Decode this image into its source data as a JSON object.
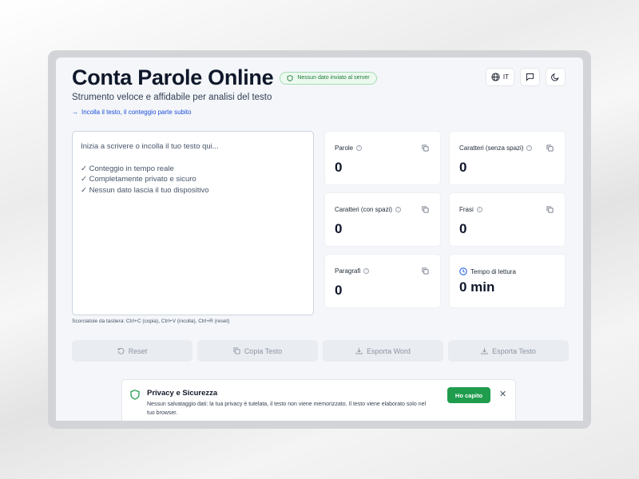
{
  "app": {
    "title": "Conta Parole Online",
    "privacy_pill": "Nessun dato inviato al server",
    "subtitle": "Strumento veloce e affidabile per analisi del testo",
    "hint": "Incolla il testo, il conteggio parte subito",
    "language": "IT"
  },
  "editor": {
    "placeholder_line1": "Inizia a scrivere o incolla il tuo testo qui...",
    "features": [
      "✓ Conteggio in tempo reale",
      "✓ Completamente privato e sicuro",
      "✓ Nessun dato lascia il tuo dispositivo"
    ],
    "shortcuts": "Scorciatoie da tastiera: Ctrl+C (copia), Ctrl+V (incolla), Ctrl+R (reset)"
  },
  "stats": [
    {
      "label": "Parole",
      "value": "0"
    },
    {
      "label": "Caratteri (senza spazi)",
      "value": "0"
    },
    {
      "label": "Caratteri (con spazi)",
      "value": "0"
    },
    {
      "label": "Frasi",
      "value": "0"
    },
    {
      "label": "Paragrafi",
      "value": "0"
    },
    {
      "label": "Tempo di lettura",
      "value": "0 min"
    }
  ],
  "actions": {
    "reset": "Reset",
    "copy": "Copia Testo",
    "export_word": "Esporta Word",
    "export_text": "Esporta Testo"
  },
  "banner": {
    "title": "Privacy e Sicurezza",
    "text": "Nessun salvataggio dati: la tua privacy è tutelata, il testo non viene memorizzato. Il testo viene elaborato solo nel tuo browser.",
    "ok_label": "Ho capito",
    "close_label": "✕"
  },
  "colors": {
    "accent_green": "#1f9d4d",
    "link_blue": "#1d4ed8",
    "title_dark": "#0f172a"
  },
  "icons": [
    "shield-icon",
    "globe-icon",
    "chat-icon",
    "moon-icon",
    "arrow-right-icon",
    "info-icon",
    "copy-icon",
    "clock-icon",
    "reset-icon",
    "download-icon",
    "close-icon"
  ]
}
